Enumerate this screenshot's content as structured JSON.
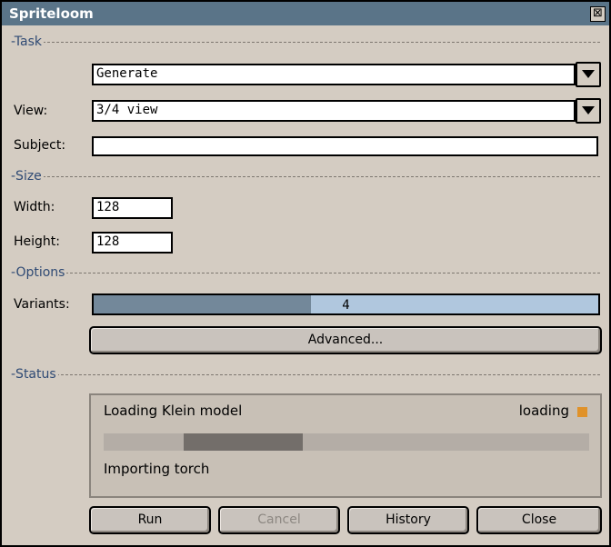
{
  "window": {
    "title": "Spriteloom",
    "close_glyph": "⊠"
  },
  "sections": {
    "task": "-Task",
    "size": "-Size",
    "options": "-Options",
    "status": "-Status"
  },
  "task": {
    "mode_value": "Generate",
    "view_label": "View:",
    "view_value": "3/4 view",
    "subject_label": "Subject:",
    "subject_value": ""
  },
  "size": {
    "width_label": "Width:",
    "width_value": "128",
    "height_label": "Height:",
    "height_value": "128"
  },
  "options": {
    "variants_label": "Variants:",
    "variants_value": "4",
    "variants_fill_fraction": 0.43,
    "advanced_label": "Advanced..."
  },
  "status": {
    "message": "Loading Klein model",
    "state": "loading",
    "state_color": "#e0922a",
    "progress_segment_start_fraction": 0.165,
    "progress_segment_end_fraction": 0.41,
    "detail": "Importing torch"
  },
  "actions": {
    "run": "Run",
    "cancel": "Cancel",
    "cancel_disabled": true,
    "history": "History",
    "close": "Close"
  },
  "colors": {
    "titlebar": "#5a7488",
    "section_label": "#2f4a74",
    "background": "#d4ccc2",
    "slider_fill": "#73889a",
    "slider_track": "#b0c7de"
  }
}
